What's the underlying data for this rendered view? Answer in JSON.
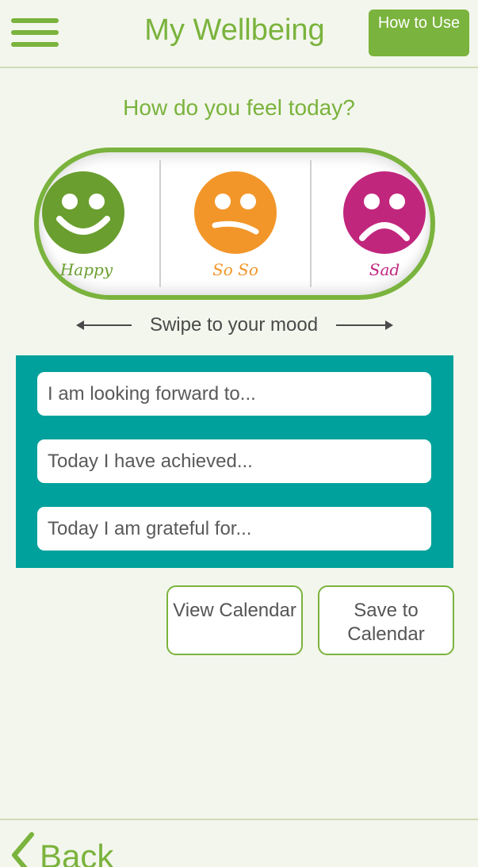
{
  "header": {
    "title": "My Wellbeing",
    "how_to_use_label": "How to Use",
    "accent_color": "#7ab33d"
  },
  "prompt": "How do you feel today?",
  "moods": [
    {
      "label": "Happy",
      "icon": "happy-face-icon",
      "color": "#6a9e2f"
    },
    {
      "label": "So So",
      "icon": "so-so-face-icon",
      "color": "#f2962a"
    },
    {
      "label": "Sad",
      "icon": "sad-face-icon",
      "color": "#c1267d"
    }
  ],
  "swipe_hint": "Swipe to your mood",
  "journal": {
    "background_color": "#00a19c",
    "fields": [
      {
        "placeholder": "I am looking forward to..."
      },
      {
        "placeholder": "Today I have achieved..."
      },
      {
        "placeholder": "Today I am grateful for..."
      }
    ]
  },
  "buttons": {
    "view_calendar": "View Calendar",
    "save_to_calendar": "Save to Calendar"
  },
  "footer": {
    "back_label": "Back"
  }
}
